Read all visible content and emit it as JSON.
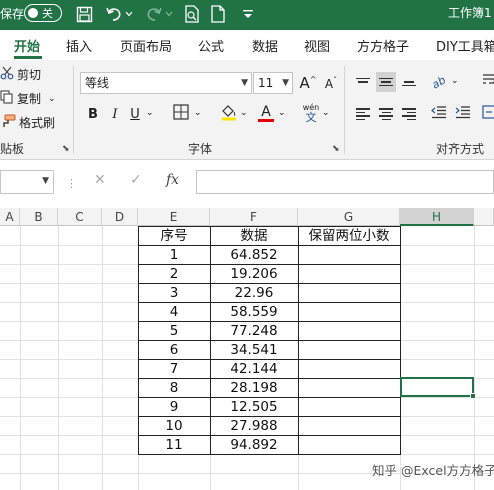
{
  "titlebar": {
    "autosave_label": "保存",
    "toggle_state": "关",
    "doc_title": "工作簿1"
  },
  "tabs": [
    {
      "label": "开始",
      "active": true
    },
    {
      "label": "插入"
    },
    {
      "label": "页面布局"
    },
    {
      "label": "公式"
    },
    {
      "label": "数据"
    },
    {
      "label": "视图"
    },
    {
      "label": "方方格子"
    },
    {
      "label": "DIY工具箱"
    }
  ],
  "ribbon": {
    "clipboard": {
      "cut": "剪切",
      "copy": "复制",
      "format_painter": "格式刷",
      "group_label": "贴板"
    },
    "font": {
      "font_name": "等线",
      "font_size": "11",
      "grow_label": "A",
      "shrink_label": "A",
      "bold": "B",
      "italic": "I",
      "underline": "U",
      "font_color_letter": "A",
      "phonetic_top": "wén",
      "phonetic_bottom": "文",
      "group_label": "字体",
      "highlight_color": "#FFE500",
      "font_color": "#E00000"
    },
    "alignment": {
      "group_label": "对齐方式",
      "orientation_label": "ab"
    }
  },
  "formula_bar": {
    "name_box": "",
    "cancel": "✕",
    "confirm": "✓",
    "fx": "fx",
    "content": ""
  },
  "grid": {
    "columns": [
      "A",
      "B",
      "C",
      "D",
      "E",
      "F",
      "G",
      "H"
    ],
    "selected_column": "H",
    "headers": [
      "序号",
      "数据",
      "保留两位小数"
    ],
    "rows": [
      {
        "seq": "1",
        "value": "64.852"
      },
      {
        "seq": "2",
        "value": "19.206"
      },
      {
        "seq": "3",
        "value": "22.96"
      },
      {
        "seq": "4",
        "value": "58.559"
      },
      {
        "seq": "5",
        "value": "77.248"
      },
      {
        "seq": "6",
        "value": "34.541"
      },
      {
        "seq": "7",
        "value": "42.144"
      },
      {
        "seq": "8",
        "value": "28.198"
      },
      {
        "seq": "9",
        "value": "12.505"
      },
      {
        "seq": "10",
        "value": "27.988"
      },
      {
        "seq": "11",
        "value": "94.892"
      }
    ]
  },
  "watermark": "知乎 @Excel方方格子",
  "colors": {
    "accent": "#217346",
    "ribbon_bg": "#f3f3f3"
  }
}
